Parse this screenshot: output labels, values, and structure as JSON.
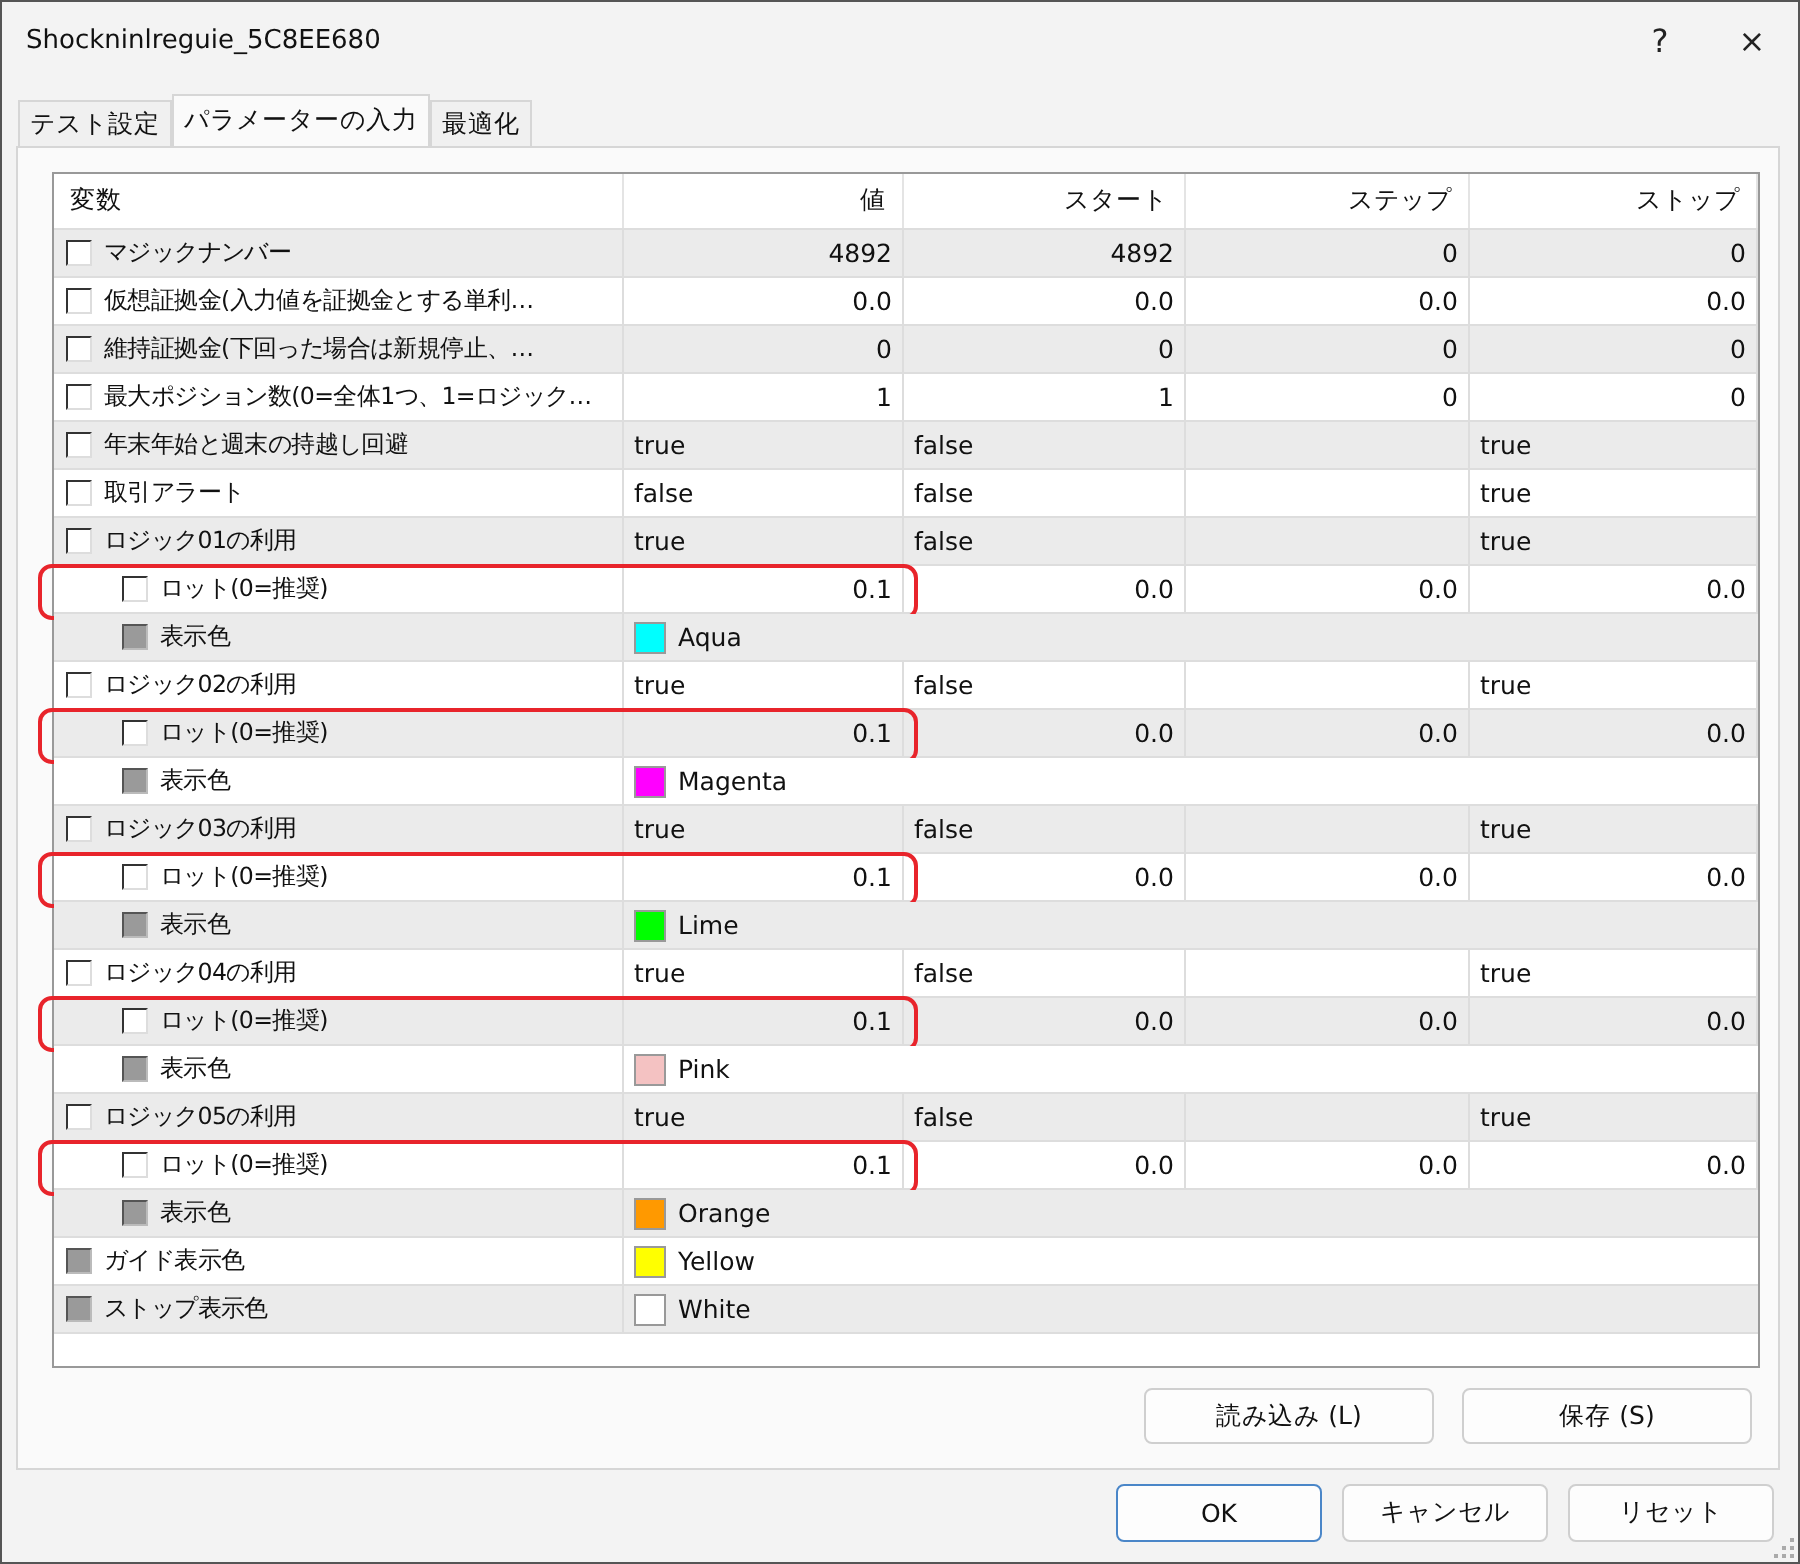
{
  "window": {
    "title": "Shockninlreguie_5C8EE680",
    "help": "?",
    "close": "×"
  },
  "tabs": [
    {
      "label": "テスト設定",
      "selected": false
    },
    {
      "label": "パラメーターの入力",
      "selected": true
    },
    {
      "label": "最適化",
      "selected": false
    }
  ],
  "table": {
    "columns": [
      "変数",
      "値",
      "スタート",
      "ステップ",
      "ストップ"
    ],
    "rows": [
      {
        "name": "マジックナンバー",
        "kind": "number",
        "checked": false,
        "disabled": false,
        "value": "4892",
        "start": "4892",
        "step": "0",
        "stop": "0"
      },
      {
        "name": "仮想証拠金(入力値を証拠金とする単利…",
        "kind": "number",
        "checked": false,
        "disabled": false,
        "value": "0.0",
        "start": "0.0",
        "step": "0.0",
        "stop": "0.0"
      },
      {
        "name": "維持証拠金(下回った場合は新規停止、…",
        "kind": "number",
        "checked": false,
        "disabled": false,
        "value": "0",
        "start": "0",
        "step": "0",
        "stop": "0"
      },
      {
        "name": "最大ポジション数(0=全体1つ、1=ロジック…",
        "kind": "number",
        "checked": false,
        "disabled": false,
        "value": "1",
        "start": "1",
        "step": "0",
        "stop": "0"
      },
      {
        "name": "年末年始と週末の持越し回避",
        "kind": "bool",
        "checked": false,
        "disabled": false,
        "value": "true",
        "start": "false",
        "stop": "true"
      },
      {
        "name": "取引アラート",
        "kind": "bool",
        "checked": false,
        "disabled": false,
        "value": "false",
        "start": "false",
        "stop": "true"
      },
      {
        "name": "ロジック01の利用",
        "kind": "bool",
        "checked": false,
        "disabled": false,
        "value": "true",
        "start": "false",
        "stop": "true",
        "children": [
          {
            "name": "ロット(0=推奨)",
            "kind": "number",
            "checked": false,
            "disabled": false,
            "highlighted": true,
            "value": "0.1",
            "start": "0.0",
            "step": "0.0",
            "stop": "0.0"
          },
          {
            "name": "表示色",
            "kind": "color",
            "checked": false,
            "disabled": true,
            "value": "Aqua",
            "color": "#00ffff"
          }
        ]
      },
      {
        "name": "ロジック02の利用",
        "kind": "bool",
        "checked": false,
        "disabled": false,
        "value": "true",
        "start": "false",
        "stop": "true",
        "children": [
          {
            "name": "ロット(0=推奨)",
            "kind": "number",
            "checked": false,
            "disabled": false,
            "highlighted": true,
            "value": "0.1",
            "start": "0.0",
            "step": "0.0",
            "stop": "0.0"
          },
          {
            "name": "表示色",
            "kind": "color",
            "checked": false,
            "disabled": true,
            "value": "Magenta",
            "color": "#ff00ff"
          }
        ]
      },
      {
        "name": "ロジック03の利用",
        "kind": "bool",
        "checked": false,
        "disabled": false,
        "value": "true",
        "start": "false",
        "stop": "true",
        "children": [
          {
            "name": "ロット(0=推奨)",
            "kind": "number",
            "checked": false,
            "disabled": false,
            "highlighted": true,
            "value": "0.1",
            "start": "0.0",
            "step": "0.0",
            "stop": "0.0"
          },
          {
            "name": "表示色",
            "kind": "color",
            "checked": false,
            "disabled": true,
            "value": "Lime",
            "color": "#00ff00"
          }
        ]
      },
      {
        "name": "ロジック04の利用",
        "kind": "bool",
        "checked": false,
        "disabled": false,
        "value": "true",
        "start": "false",
        "stop": "true",
        "children": [
          {
            "name": "ロット(0=推奨)",
            "kind": "number",
            "checked": false,
            "disabled": false,
            "highlighted": true,
            "value": "0.1",
            "start": "0.0",
            "step": "0.0",
            "stop": "0.0"
          },
          {
            "name": "表示色",
            "kind": "color",
            "checked": false,
            "disabled": true,
            "value": "Pink",
            "color": "#f4c2c2"
          }
        ]
      },
      {
        "name": "ロジック05の利用",
        "kind": "bool",
        "checked": false,
        "disabled": false,
        "value": "true",
        "start": "false",
        "stop": "true",
        "children": [
          {
            "name": "ロット(0=推奨)",
            "kind": "number",
            "checked": false,
            "disabled": false,
            "highlighted": true,
            "value": "0.1",
            "start": "0.0",
            "step": "0.0",
            "stop": "0.0"
          },
          {
            "name": "表示色",
            "kind": "color",
            "checked": false,
            "disabled": true,
            "value": "Orange",
            "color": "#ff9900"
          }
        ]
      },
      {
        "name": "ガイド表示色",
        "kind": "color",
        "checked": false,
        "disabled": true,
        "value": "Yellow",
        "color": "#ffff00"
      },
      {
        "name": "ストップ表示色",
        "kind": "color",
        "checked": false,
        "disabled": true,
        "value": "White",
        "color": "#ffffff"
      }
    ]
  },
  "file_buttons": [
    "読み込み (L)",
    "保存 (S)"
  ],
  "dialog_buttons": [
    {
      "label": "OK",
      "default": true
    },
    {
      "label": "キャンセル",
      "default": false
    },
    {
      "label": "リセット",
      "default": false
    }
  ]
}
